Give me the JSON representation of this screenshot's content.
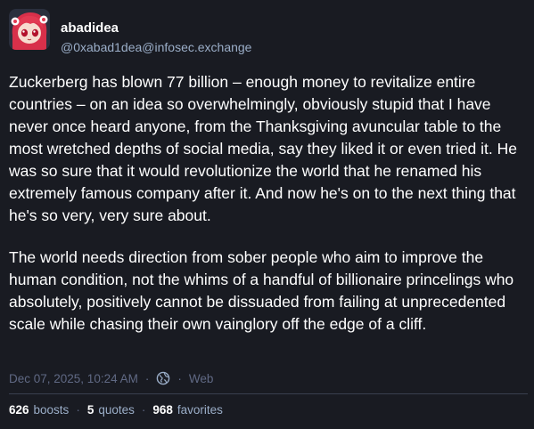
{
  "account": {
    "display_name": "abadidea",
    "handle": "@0xabad1dea@infosec.exchange",
    "avatar": "avatar-image"
  },
  "post": {
    "paragraphs": [
      "Zuckerberg has blown 77 billion – enough money to revitalize entire countries – on an idea so overwhelmingly, obviously stupid that I have never once heard anyone, from the Thanksgiving avuncular table to the most wretched depths of social media, say they liked it or even tried it. He was so sure that it would revolutionize the world that he renamed his extremely famous company after it. And now he's on to the next thing that he's so very, very sure about.",
      "The world needs direction from sober people who aim to improve the human condition, not the whims of a handful of billionaire princelings who absolutely, positively cannot be dissuaded from failing at unprecedented scale while chasing their own vainglory off the edge of a cliff."
    ]
  },
  "meta": {
    "timestamp": "Dec 07, 2025, 10:24 AM",
    "separator": "·",
    "visibility_icon": "globe-icon",
    "application": "Web"
  },
  "stats": {
    "boosts_count": "626",
    "boosts_label": "boosts",
    "quotes_count": "5",
    "quotes_label": "quotes",
    "favorites_count": "968",
    "favorites_label": "favorites",
    "separator": "·"
  },
  "colors": {
    "background": "#191b22",
    "text": "#ffffff",
    "secondary_text": "#9baec8",
    "muted_text": "#606984"
  }
}
